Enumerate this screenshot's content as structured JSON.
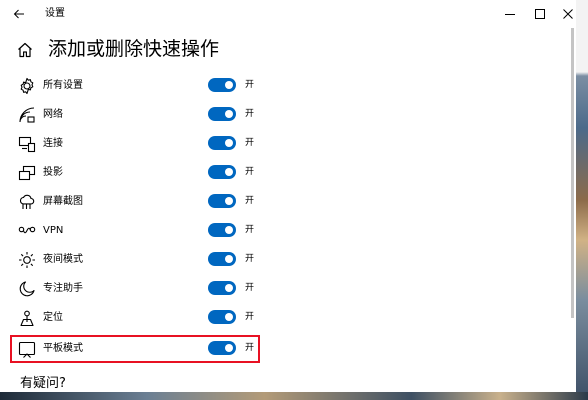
{
  "window": {
    "title": "设置",
    "controls": {
      "minimize": "minimize-icon",
      "maximize": "maximize-icon",
      "close": "close-icon"
    }
  },
  "page": {
    "title": "添加或删除快速操作"
  },
  "rows": [
    {
      "label": "所有设置",
      "state": "开",
      "on": true,
      "icon": "gear-icon"
    },
    {
      "label": "网络",
      "state": "开",
      "on": true,
      "icon": "network-icon"
    },
    {
      "label": "连接",
      "state": "开",
      "on": true,
      "icon": "connect-icon"
    },
    {
      "label": "投影",
      "state": "开",
      "on": true,
      "icon": "project-icon"
    },
    {
      "label": "屏幕截图",
      "state": "开",
      "on": true,
      "icon": "screenshot-icon"
    },
    {
      "label": "VPN",
      "state": "开",
      "on": true,
      "icon": "vpn-icon"
    },
    {
      "label": "夜间模式",
      "state": "开",
      "on": true,
      "icon": "night-light-icon"
    },
    {
      "label": "专注助手",
      "state": "开",
      "on": true,
      "icon": "moon-icon"
    },
    {
      "label": "定位",
      "state": "开",
      "on": true,
      "icon": "location-icon"
    },
    {
      "label": "平板模式",
      "state": "开",
      "on": true,
      "icon": "tablet-mode-icon"
    }
  ],
  "footer": {
    "question": "有疑问?"
  },
  "colors": {
    "accent": "#0067c0",
    "highlight": "#e81123"
  }
}
